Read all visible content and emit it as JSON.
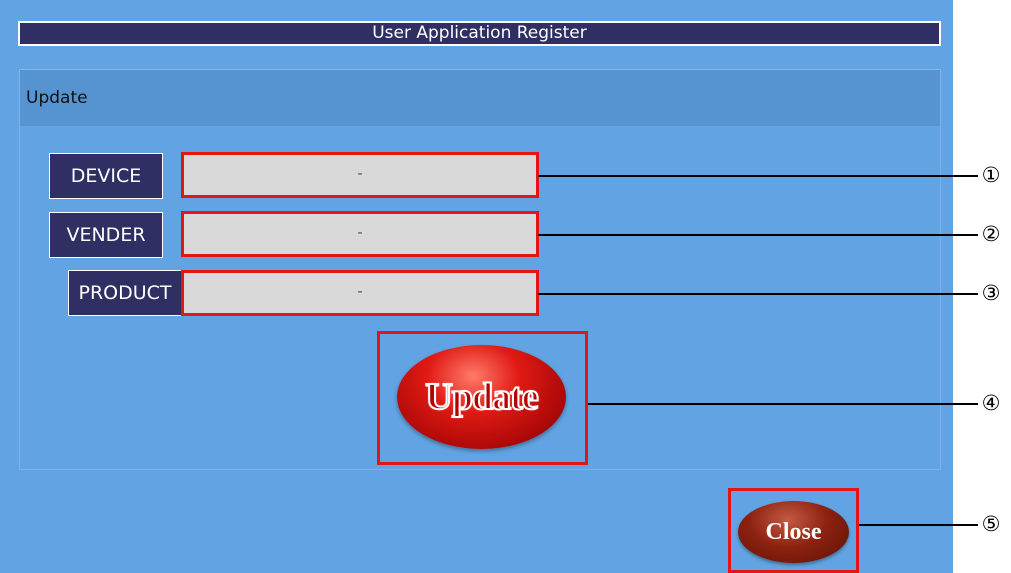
{
  "window": {
    "title": "User Application Register"
  },
  "group": {
    "header": "Update"
  },
  "fields": {
    "device": {
      "label": "DEVICE",
      "value": "-"
    },
    "vender": {
      "label": "VENDER",
      "value": "-"
    },
    "product": {
      "label": "PRODUCT",
      "value": "-"
    }
  },
  "buttons": {
    "update_label": "Update",
    "close_label": "Close"
  },
  "callouts": [
    "①",
    "②",
    "③",
    "④",
    "⑤"
  ],
  "colors": {
    "panel_bg": "#62a4e3",
    "title_bar": "#2f2f63",
    "highlight": "#e31515",
    "update_button": "#e01a14",
    "close_button": "#8d2210"
  }
}
